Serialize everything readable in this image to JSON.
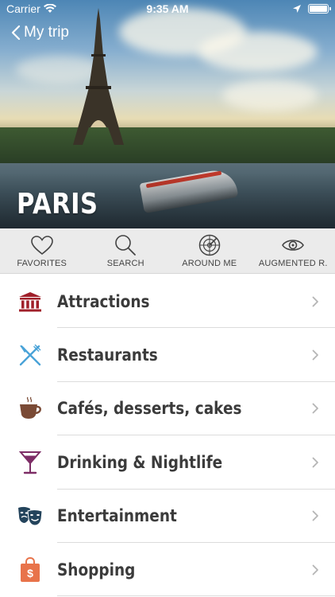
{
  "status_bar": {
    "carrier": "Carrier",
    "time": "9:35 AM"
  },
  "header": {
    "back_label": "My trip",
    "city": "PARIS"
  },
  "toolbar": {
    "items": [
      {
        "label": "FAVORITES",
        "icon": "heart-icon"
      },
      {
        "label": "SEARCH",
        "icon": "search-icon"
      },
      {
        "label": "AROUND ME",
        "icon": "radar-icon"
      },
      {
        "label": "AUGMENTED R.",
        "icon": "eye-icon"
      }
    ]
  },
  "categories": [
    {
      "label": "Attractions",
      "icon": "museum-icon",
      "color": "#a0202a"
    },
    {
      "label": "Restaurants",
      "icon": "fork-knife-icon",
      "color": "#4aa3d8"
    },
    {
      "label": "Cafés, desserts, cakes",
      "icon": "coffee-cup-icon",
      "color": "#7a4a35"
    },
    {
      "label": "Drinking & Nightlife",
      "icon": "cocktail-icon",
      "color": "#7d2d66"
    },
    {
      "label": "Entertainment",
      "icon": "theater-masks-icon",
      "color": "#24445c"
    },
    {
      "label": "Shopping",
      "icon": "shopping-bag-icon",
      "color": "#e8734a"
    }
  ]
}
